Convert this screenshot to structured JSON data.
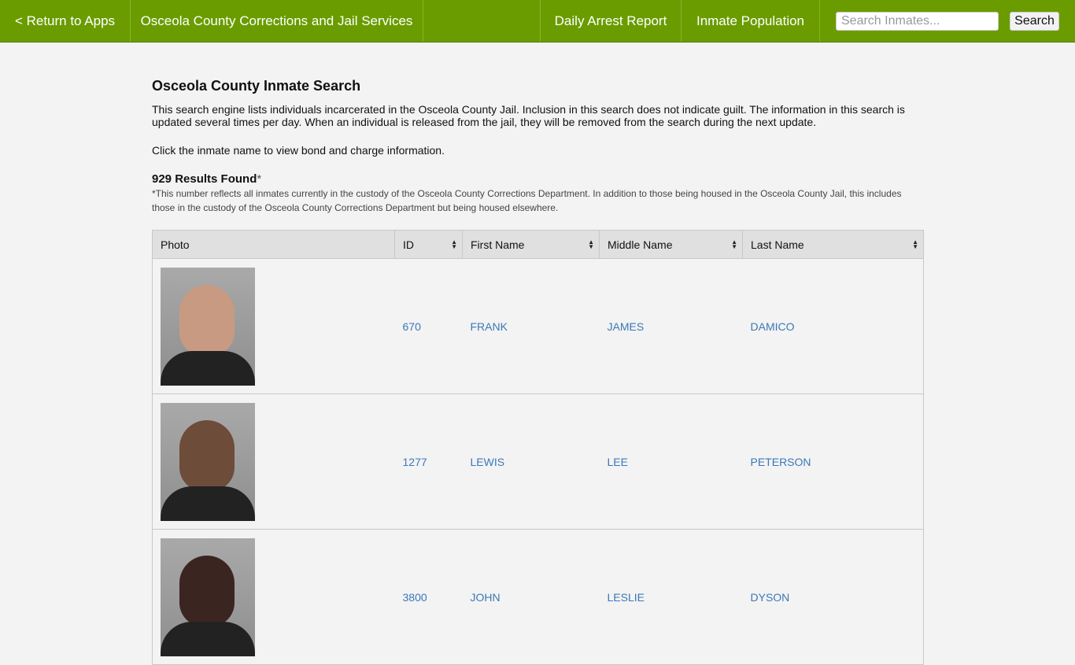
{
  "nav": {
    "return_label": "< Return to Apps",
    "site_title": "Osceola County Corrections and Jail Services",
    "daily_arrest": "Daily Arrest Report",
    "inmate_population": "Inmate Population",
    "search_placeholder": "Search Inmates...",
    "search_button": "Search"
  },
  "main": {
    "title": "Osceola County Inmate Search",
    "intro": "This search engine lists individuals incarcerated in the Osceola County Jail. Inclusion in this search does not indicate guilt. The information in this search is updated several times per day. When an individual is released from the jail, they will be removed from the search during the next update.",
    "click_note": "Click the inmate name to view bond and charge information.",
    "results_count": "929 Results Found",
    "results_asterisk": "*",
    "footnote": "*This number reflects all inmates currently in the custody of the Osceola County Corrections Department. In addition to those being housed in the Osceola County Jail, this includes those in the custody of the Osceola County Corrections Department but being housed elsewhere."
  },
  "table": {
    "headers": [
      "Photo",
      "ID",
      "First Name",
      "Middle Name",
      "Last Name"
    ],
    "rows": [
      {
        "id": "670",
        "first": "FRANK",
        "middle": "JAMES",
        "last": "DAMICO"
      },
      {
        "id": "1277",
        "first": "LEWIS",
        "middle": "LEE",
        "last": "PETERSON"
      },
      {
        "id": "3800",
        "first": "JOHN",
        "middle": "LESLIE",
        "last": "DYSON"
      }
    ]
  },
  "colors": {
    "nav_bg": "#6a9c00",
    "link": "#3a78b8"
  }
}
